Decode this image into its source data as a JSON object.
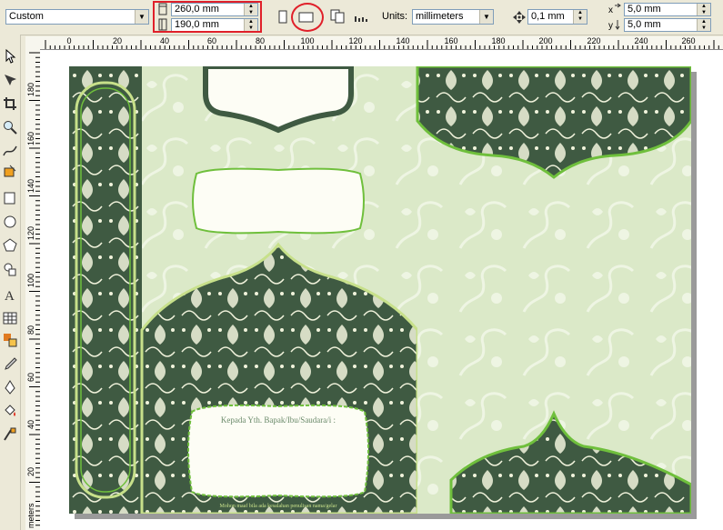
{
  "propbar": {
    "paper_preset": "Custom",
    "width_value": "260,0 mm",
    "height_value": "190,0 mm",
    "units_label": "Units:",
    "units_value": "millimeters",
    "nudge_value": "0,1 mm",
    "dup_x_value": "5,0 mm",
    "dup_y_value": "5,0 mm"
  },
  "rulers": {
    "horizontal": [
      "20",
      "0",
      "20",
      "40",
      "60",
      "80",
      "100",
      "120",
      "140",
      "160",
      "180",
      "200",
      "220",
      "240",
      "260"
    ],
    "vertical": [
      "180",
      "160",
      "140",
      "120",
      "100",
      "80",
      "60",
      "40",
      "20"
    ],
    "units_caption": "meters"
  },
  "design": {
    "label_text": "Kepada Yth. Bapak/Ibu/Saudara/i :",
    "footer_text": "Mohon maaf bila ada kesalahan penulisan nama/gelar"
  },
  "colors": {
    "dark_green": "#3f5a42",
    "light_green": "#dbe9c8",
    "accent_green": "#6fbf3c",
    "cream": "#f1f3dc",
    "highlight_red": "#e0202a"
  }
}
